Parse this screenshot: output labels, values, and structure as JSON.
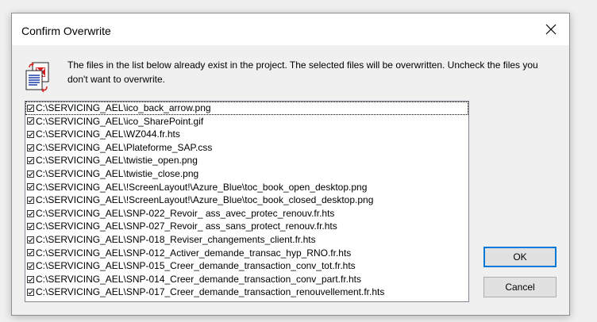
{
  "window": {
    "title": "Confirm Overwrite",
    "close_glyph": "✕"
  },
  "message": "The files in the list below already exist in the project. The selected files will be overwritten. Uncheck the files you don't want to overwrite.",
  "files": [
    {
      "path": "C:\\SERVICING_AEL\\ico_back_arrow.png",
      "checked": true
    },
    {
      "path": "C:\\SERVICING_AEL\\ico_SharePoint.gif",
      "checked": true
    },
    {
      "path": "C:\\SERVICING_AEL\\WZ044.fr.hts",
      "checked": true
    },
    {
      "path": "C:\\SERVICING_AEL\\Plateforme_SAP.css",
      "checked": true
    },
    {
      "path": "C:\\SERVICING_AEL\\twistie_open.png",
      "checked": true
    },
    {
      "path": "C:\\SERVICING_AEL\\twistie_close.png",
      "checked": true
    },
    {
      "path": "C:\\SERVICING_AEL\\!ScreenLayout!\\Azure_Blue\\toc_book_open_desktop.png",
      "checked": true
    },
    {
      "path": "C:\\SERVICING_AEL\\!ScreenLayout!\\Azure_Blue\\toc_book_closed_desktop.png",
      "checked": true
    },
    {
      "path": "C:\\SERVICING_AEL\\SNP-022_Revoir_ ass_avec_protec_renouv.fr.hts",
      "checked": true
    },
    {
      "path": "C:\\SERVICING_AEL\\SNP-027_Revoir_ ass_sans_protect_renouv.fr.hts",
      "checked": true
    },
    {
      "path": "C:\\SERVICING_AEL\\SNP-018_Reviser_changements_client.fr.hts",
      "checked": true
    },
    {
      "path": "C:\\SERVICING_AEL\\SNP-012_Activer_demande_transac_hyp_RNO.fr.hts",
      "checked": true
    },
    {
      "path": "C:\\SERVICING_AEL\\SNP-015_Creer_demande_transaction_conv_tot.fr.hts",
      "checked": true
    },
    {
      "path": "C:\\SERVICING_AEL\\SNP-014_Creer_demande_transaction_conv_part.fr.hts",
      "checked": true
    },
    {
      "path": "C:\\SERVICING_AEL\\SNP-017_Creer_demande_transaction_renouvellement.fr.hts",
      "checked": true
    }
  ],
  "buttons": {
    "ok": "OK",
    "cancel": "Cancel"
  },
  "icons": {
    "message_icon": "files-overwrite-icon",
    "close": "close-icon",
    "checkbox": "checkbox-checked-icon"
  },
  "colors": {
    "accent": "#0078d7",
    "icon_red": "#d42020",
    "icon_blue": "#1a3fa8"
  }
}
